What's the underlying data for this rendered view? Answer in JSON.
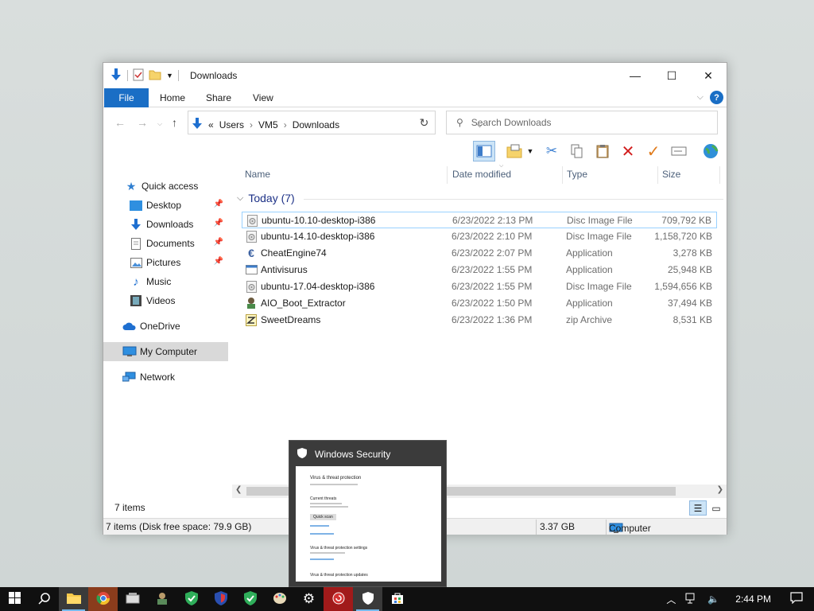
{
  "window": {
    "title": "Downloads",
    "minimize": "—",
    "maximize": "☐",
    "close": "✕"
  },
  "ribbon": {
    "tabs": [
      "File",
      "Home",
      "Share",
      "View"
    ],
    "help": "?"
  },
  "address": {
    "separator": "«",
    "crumbs": [
      "Users",
      "VM5",
      "Downloads"
    ],
    "search_placeholder": "Search Downloads"
  },
  "navpane": {
    "items": [
      {
        "label": "Quick access",
        "icon": "star-icon"
      },
      {
        "label": "Desktop",
        "icon": "desktop-icon",
        "pinned": true
      },
      {
        "label": "Downloads",
        "icon": "download-icon",
        "pinned": true
      },
      {
        "label": "Documents",
        "icon": "document-icon",
        "pinned": true
      },
      {
        "label": "Pictures",
        "icon": "picture-icon",
        "pinned": true
      },
      {
        "label": "Music",
        "icon": "music-icon"
      },
      {
        "label": "Videos",
        "icon": "video-icon"
      },
      {
        "label": "OneDrive",
        "icon": "cloud-icon"
      },
      {
        "label": "My Computer",
        "icon": "computer-icon",
        "selected": true
      },
      {
        "label": "Network",
        "icon": "network-icon"
      }
    ]
  },
  "list": {
    "columns": [
      "Name",
      "Date modified",
      "Type",
      "Size"
    ],
    "group_label": "Today (7)",
    "files": [
      {
        "name": "ubuntu-10.10-desktop-i386",
        "date": "6/23/2022 2:13 PM",
        "type": "Disc Image File",
        "size": "709,792 KB",
        "icon": "disc-image-icon"
      },
      {
        "name": "ubuntu-14.10-desktop-i386",
        "date": "6/23/2022 2:10 PM",
        "type": "Disc Image File",
        "size": "1,158,720 KB",
        "icon": "disc-image-icon"
      },
      {
        "name": "CheatEngine74",
        "date": "6/23/2022 2:07 PM",
        "type": "Application",
        "size": "3,278 KB",
        "icon": "cheat-engine-icon"
      },
      {
        "name": "Antivisurus",
        "date": "6/23/2022 1:55 PM",
        "type": "Application",
        "size": "25,948 KB",
        "icon": "application-icon"
      },
      {
        "name": "ubuntu-17.04-desktop-i386",
        "date": "6/23/2022 1:55 PM",
        "type": "Disc Image File",
        "size": "1,594,656 KB",
        "icon": "disc-image-icon"
      },
      {
        "name": "AIO_Boot_Extractor",
        "date": "6/23/2022 1:50 PM",
        "type": "Application",
        "size": "37,494 KB",
        "icon": "aio-boot-icon"
      },
      {
        "name": "SweetDreams",
        "date": "6/23/2022 1:36 PM",
        "type": "zip Archive",
        "size": "8,531 KB",
        "icon": "zip-archive-icon"
      }
    ]
  },
  "status": {
    "item_count": "7 items",
    "summary": "7 items (Disk free space: 79.9 GB)",
    "size": "3.37 GB",
    "location": "Computer"
  },
  "preview": {
    "title": "Windows Security",
    "lines": [
      "Virus & threat protection",
      "Current threats",
      "Quick scan",
      "Virus & threat protection settings",
      "Virus & threat protection updates"
    ]
  },
  "taskbar": {
    "time": "2:44 PM"
  }
}
